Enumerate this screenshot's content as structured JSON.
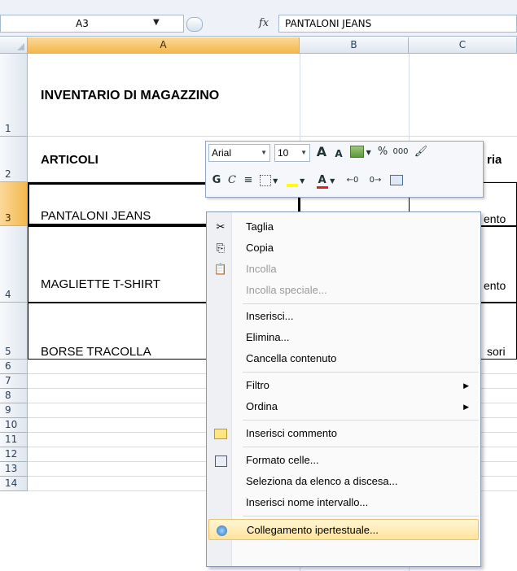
{
  "formula_bar": {
    "name_box": "A3",
    "fx_label": "fx",
    "content": "PANTALONI JEANS"
  },
  "columns": [
    "A",
    "B",
    "C"
  ],
  "rows": [
    "1",
    "2",
    "3",
    "4",
    "5",
    "6",
    "7",
    "8",
    "9",
    "10",
    "11",
    "12",
    "13",
    "14"
  ],
  "sheet": {
    "title": "INVENTARIO DI MAGAZZINO",
    "header_a": "ARTICOLI",
    "header_c_partial": "ria",
    "items": [
      {
        "name": "PANTALONI JEANS",
        "c_partial": "ento"
      },
      {
        "name": "MAGLIETTE T-SHIRT",
        "c_partial": "ento"
      },
      {
        "name": "BORSE TRACOLLA",
        "c_partial": "sori"
      }
    ]
  },
  "mini_toolbar": {
    "font": "Arial",
    "size": "10",
    "grow": "A",
    "shrink": "A",
    "percent": "%",
    "thousands": "000",
    "bold": "G",
    "italic": "C"
  },
  "context_menu": {
    "items": [
      {
        "label": "Taglia",
        "icon": "scissors-icon",
        "enabled": true
      },
      {
        "label": "Copia",
        "icon": "copy-icon",
        "enabled": true
      },
      {
        "label": "Incolla",
        "icon": "paste-icon",
        "enabled": false
      },
      {
        "label": "Incolla speciale...",
        "enabled": false
      },
      {
        "label": "Inserisci...",
        "enabled": true
      },
      {
        "label": "Elimina...",
        "enabled": true
      },
      {
        "label": "Cancella contenuto",
        "enabled": true
      },
      {
        "label": "Filtro",
        "submenu": true,
        "enabled": true
      },
      {
        "label": "Ordina",
        "submenu": true,
        "enabled": true
      },
      {
        "label": "Inserisci commento",
        "icon": "comment-icon",
        "enabled": true
      },
      {
        "label": "Formato celle...",
        "icon": "format-cells-icon",
        "enabled": true
      },
      {
        "label": "Seleziona da elenco a discesa...",
        "enabled": true
      },
      {
        "label": "Inserisci nome intervallo...",
        "enabled": true
      },
      {
        "label": "Collegamento ipertestuale...",
        "icon": "hyperlink-icon",
        "enabled": true,
        "highlighted": true
      }
    ]
  }
}
